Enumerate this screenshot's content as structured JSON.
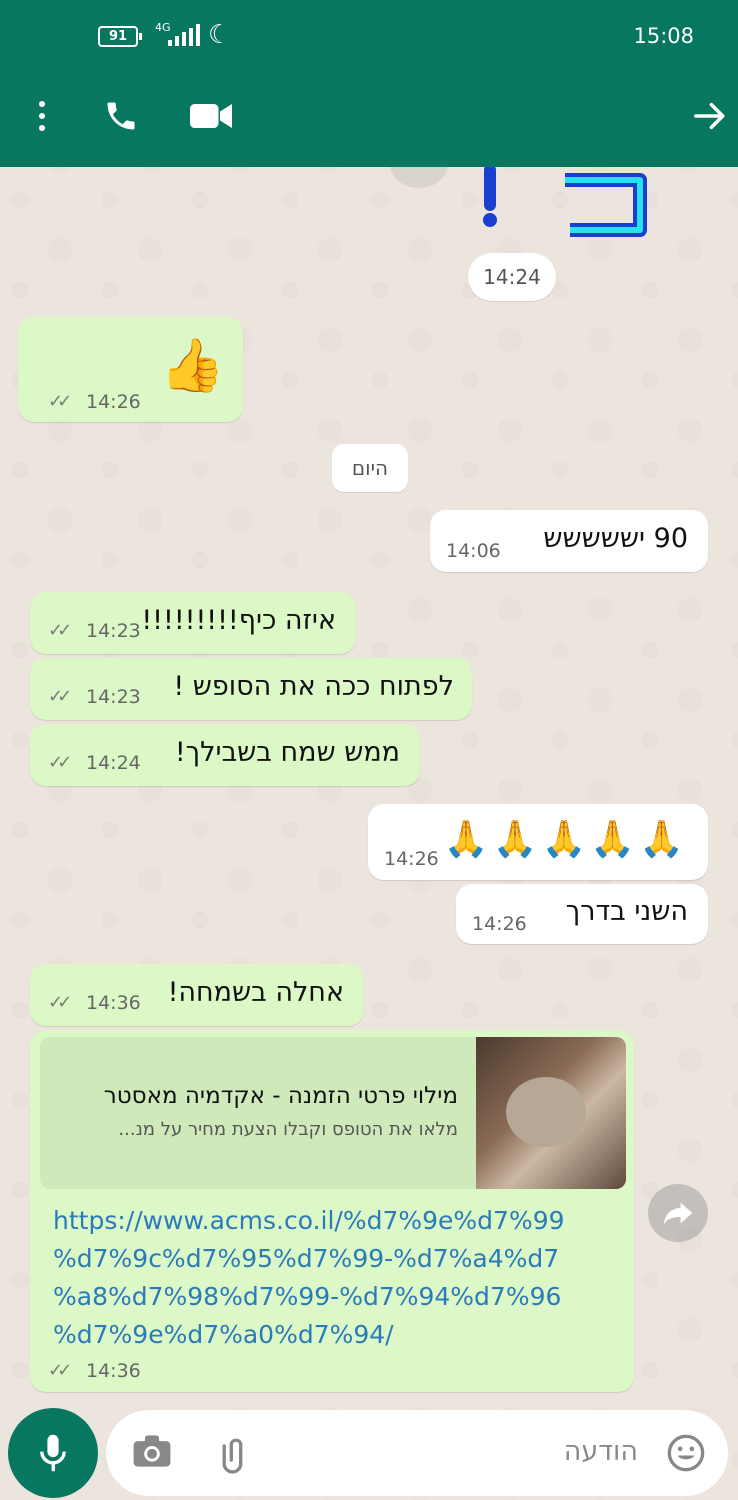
{
  "status_bar": {
    "battery": "91",
    "network": "4G",
    "time": "15:08"
  },
  "header": {
    "icons": [
      "more-vert-icon",
      "phone-icon",
      "video-camera-icon",
      "back-arrow-icon"
    ]
  },
  "date_chip": "היום",
  "sticker_time": "14:24",
  "messages": [
    {
      "id": "thumbs",
      "direction": "incoming",
      "text": "👍",
      "time": "14:26"
    },
    {
      "id": "m1",
      "direction": "outgoing",
      "text": "90 יששששש",
      "time": "14:06"
    },
    {
      "id": "m2",
      "direction": "incoming",
      "text": "איזה כיף!!!!!!!!!",
      "time": "14:23"
    },
    {
      "id": "m3",
      "direction": "incoming",
      "text": "לפתוח ככה את הסופש !",
      "time": "14:23"
    },
    {
      "id": "m4",
      "direction": "incoming",
      "text": "ממש שמח בשבילך!",
      "time": "14:24"
    },
    {
      "id": "m5",
      "direction": "outgoing",
      "text": "🙏🙏🙏🙏🙏",
      "time": "14:26"
    },
    {
      "id": "m6",
      "direction": "outgoing",
      "text": "השני בדרך",
      "time": "14:26"
    },
    {
      "id": "m7",
      "direction": "incoming",
      "text": "אחלה בשמחה!",
      "time": "14:36"
    }
  ],
  "link_message": {
    "title": "מילוי פרטי הזמנה - אקדמיה מאסטר",
    "description": "מלאו את הטופס וקבלו הצעת מחיר על מנ...",
    "url_lines": [
      "https://www.acms.co.il/%d7%9e%d7%99",
      "%d7%9c%d7%95%d7%99-%d7%a4%d7",
      "%a8%d7%98%d7%99-%d7%94%d7%96",
      "%d7%9e%d7%a0%d7%94/"
    ],
    "time": "14:36"
  },
  "composer": {
    "placeholder": "הודעה"
  },
  "colors": {
    "header": "#08775f",
    "incoming_bubble": "#dcf8c6",
    "outgoing_bubble": "#ffffff",
    "link": "#2b7bb9",
    "background": "#ece5dd"
  }
}
